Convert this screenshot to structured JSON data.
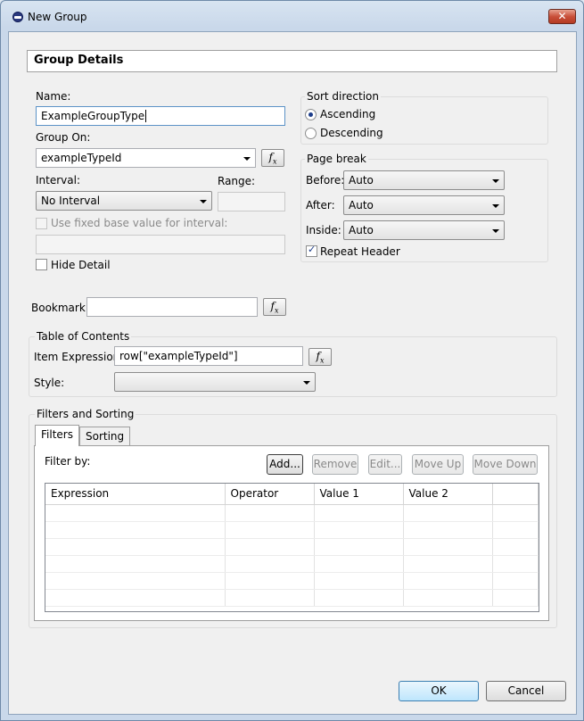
{
  "window": {
    "title": "New Group",
    "close_symbol": "✕"
  },
  "header": {
    "title": "Group Details"
  },
  "left": {
    "name_label": "Name:",
    "name_value": "ExampleGroupType",
    "group_on_label": "Group On:",
    "group_on_value": "exampleTypeId",
    "interval_label": "Interval:",
    "interval_value": "No Interval",
    "range_label": "Range:",
    "fixed_base_label": "Use fixed base value for interval:",
    "hide_detail_label": "Hide Detail"
  },
  "sort": {
    "title": "Sort direction",
    "ascending": "Ascending",
    "descending": "Descending",
    "selected": "Ascending"
  },
  "page_break": {
    "title": "Page break",
    "before_label": "Before:",
    "before_value": "Auto",
    "after_label": "After:",
    "after_value": "Auto",
    "inside_label": "Inside:",
    "inside_value": "Auto",
    "repeat_header_label": "Repeat Header",
    "repeat_header_checked": true
  },
  "bookmark": {
    "label": "Bookmark:",
    "value": ""
  },
  "toc": {
    "title": "Table of Contents",
    "item_expression_label": "Item Expression:",
    "item_expression_value": "row[\"exampleTypeId\"]",
    "style_label": "Style:",
    "style_value": ""
  },
  "filters": {
    "title": "Filters and Sorting",
    "tabs": [
      "Filters",
      "Sorting"
    ],
    "active_tab": "Filters",
    "filter_by_label": "Filter by:",
    "buttons": {
      "add": "Add...",
      "remove": "Remove",
      "edit": "Edit...",
      "move_up": "Move Up",
      "move_down": "Move Down"
    },
    "columns": [
      "Expression",
      "Operator",
      "Value 1",
      "Value 2",
      ""
    ]
  },
  "footer": {
    "ok": "OK",
    "cancel": "Cancel"
  },
  "icons": {
    "fx": "fx-expression-icon"
  }
}
